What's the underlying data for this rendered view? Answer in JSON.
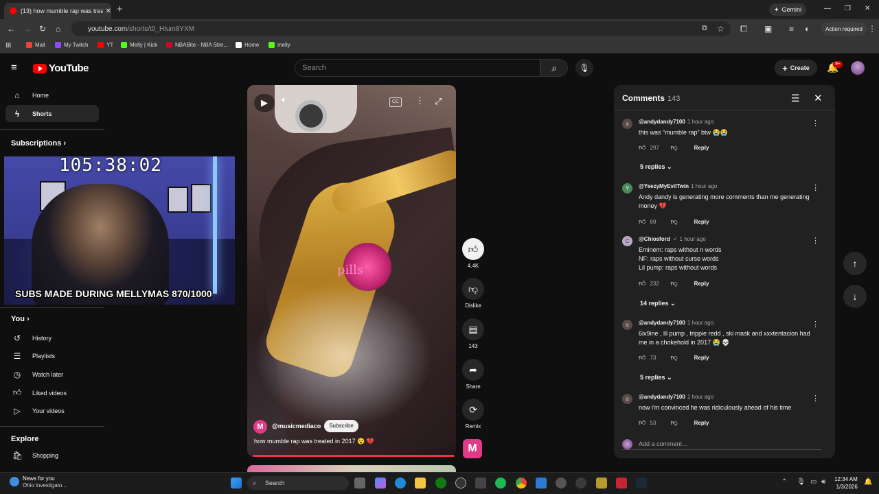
{
  "browser": {
    "tab_title": "(13) how mumble rap was treat",
    "url_host": "youtube.com",
    "url_path": "/shorts/t0_Htum8YXM",
    "gemini_label": "Gemini",
    "action_required": "Action required",
    "bookmarks": [
      "Mail",
      "My Twitch",
      "YT",
      "Melly | Kick",
      "NBABite - NBA Stre...",
      "Home",
      "melly"
    ]
  },
  "header": {
    "logo": "YouTube",
    "search_placeholder": "Search",
    "create_label": "Create",
    "notif_count": "9+"
  },
  "sidebar": {
    "home": "Home",
    "shorts": "Shorts",
    "subscriptions": "Subscriptions",
    "you": "You",
    "history": "History",
    "playlists": "Playlists",
    "watch_later": "Watch later",
    "liked": "Liked videos",
    "your_videos": "Your videos",
    "explore": "Explore",
    "shopping": "Shopping"
  },
  "overlay": {
    "timer": "105:38:02",
    "subs_goal": "SUBS MADE DURING MELLYMAS 870/1000"
  },
  "short": {
    "overlay_text": "pills",
    "channel": "@musicmediaco",
    "subscribe": "Subscribe",
    "title": "how mumble rap was treated in 2017 😵 💔",
    "likes": "4.4K",
    "dislike": "Dislike",
    "comments_count": "143",
    "share": "Share",
    "remix": "Remix",
    "cc": "CC"
  },
  "comments": {
    "heading": "Comments",
    "count": "143",
    "add_placeholder": "Add a comment...",
    "reply_label": "Reply",
    "items": [
      {
        "author": "@andydandy7100",
        "time": "1 hour ago",
        "text": "this was “mumble rap” btw 😭😭",
        "likes": "297",
        "replies": "5 replies"
      },
      {
        "author": "@YeezyMyEvilTwin",
        "time": "1 hour ago",
        "text": "Andy dandy is generating more comments than me generating money 💔",
        "likes": "69",
        "replies": ""
      },
      {
        "author": "@Chiosford",
        "time": "1 hour ago",
        "text": "Eminem: raps without n words\nNF: raps without curse words\nLil pump: raps without words",
        "likes": "232",
        "replies": "14 replies"
      },
      {
        "author": "@andydandy7100",
        "time": "1 hour ago",
        "text": "6ix9ine , lil pump , trippie redd , ski mask and xxxtentacion had me in a chokehold in 2017 😭 💀",
        "likes": "73",
        "replies": "5 replies"
      },
      {
        "author": "@andydandy7100",
        "time": "1 hour ago",
        "text": "now i'm convinced he was ridiculously ahead of his time",
        "likes": "53",
        "replies": ""
      }
    ]
  },
  "taskbar": {
    "news_title": "News for you",
    "news_sub": "Ohio investigato...",
    "search": "Search",
    "time": "12:34 AM",
    "date": "1/3/2026"
  }
}
